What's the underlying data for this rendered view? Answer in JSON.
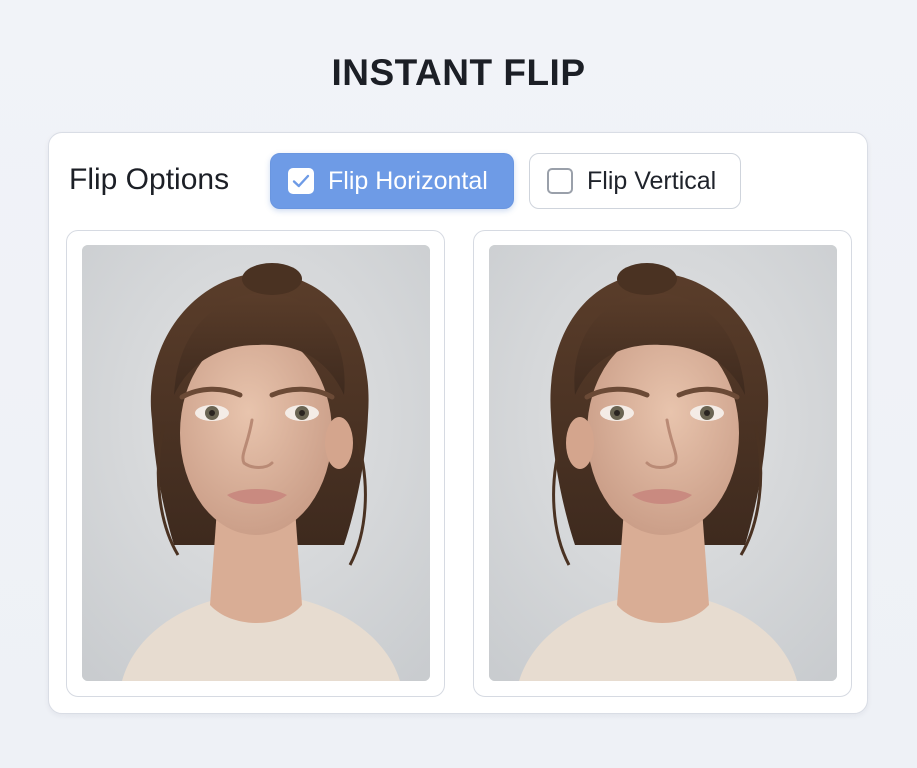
{
  "app": {
    "title": "INSTANT FLIP"
  },
  "options": {
    "label": "Flip Options",
    "items": [
      {
        "label": "Flip Horizontal",
        "checked": true,
        "icon": "checkmark-icon"
      },
      {
        "label": "Flip Vertical",
        "checked": false,
        "icon": "empty-checkbox-icon"
      }
    ]
  },
  "images": [
    {
      "name": "original",
      "mirrored": false
    },
    {
      "name": "flipped",
      "mirrored": true
    }
  ],
  "colors": {
    "accent": "#6e9be6",
    "background": "#eef1f6",
    "text": "#1c1f26"
  }
}
